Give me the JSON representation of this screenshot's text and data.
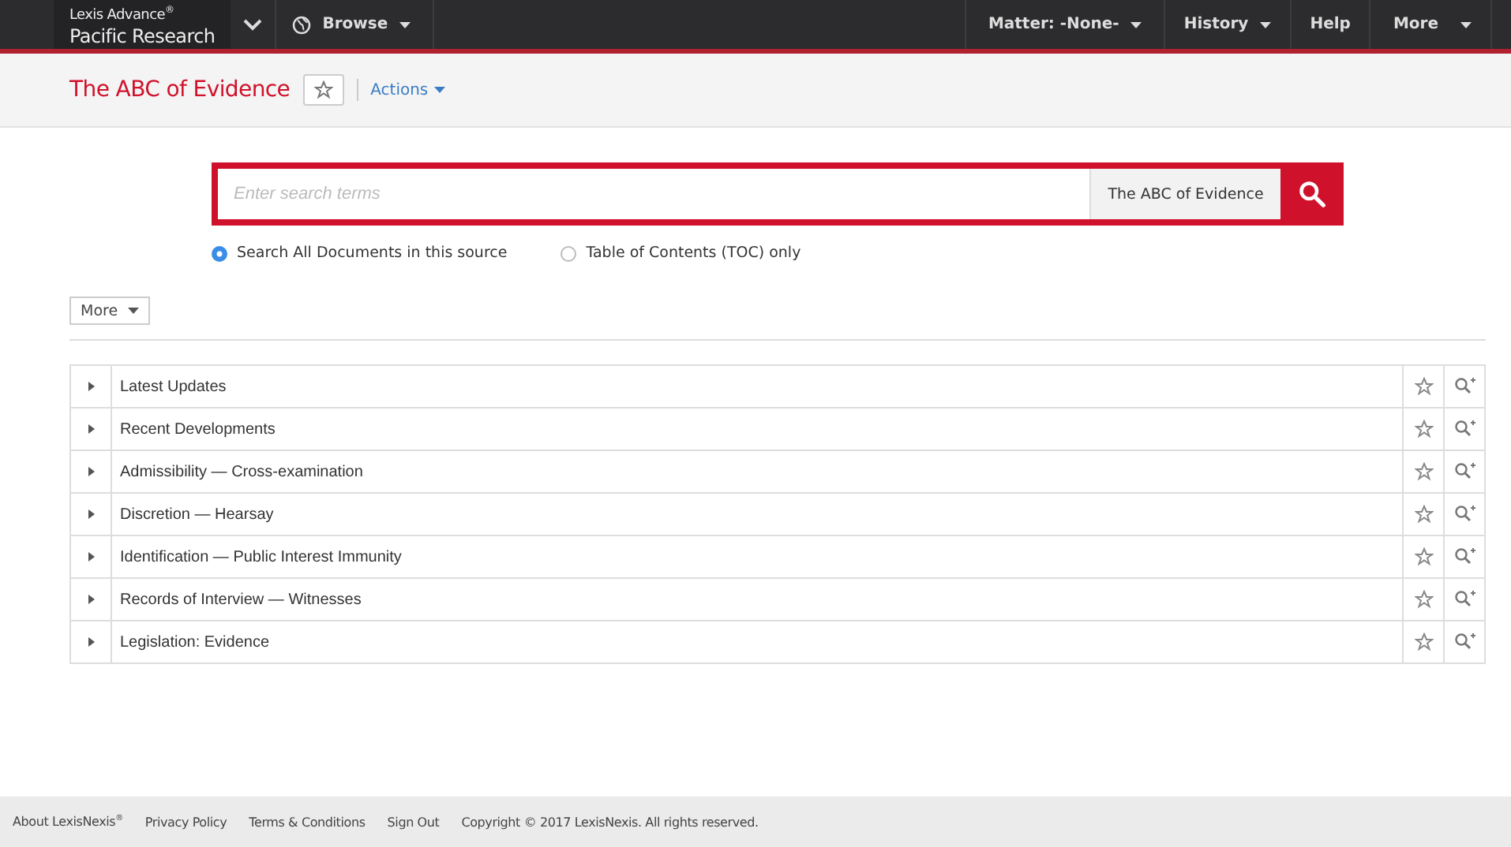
{
  "top_bar": {
    "brand": {
      "product": "Lexis Advance$^{®}$",
      "name": "Pacific Research"
    },
    "left_items": [
      {
        "label": "Browse",
        "kind": "dropdown"
      }
    ],
    "right_items": [
      {
        "label": "Matter: -None-",
        "kind": "dropdown"
      },
      {
        "label": "History",
        "kind": "dropdown"
      },
      {
        "label": "Help",
        "kind": "link"
      },
      {
        "label": "More",
        "kind": "dropdown"
      }
    ]
  },
  "header": {
    "title": "The ABC of Evidence",
    "actions": "Actions"
  },
  "search": {
    "placeholder": "Enter search terms",
    "source": "The ABC of Evidence",
    "scopes": [
      {
        "label": "Search All Documents in this source",
        "selected": true
      },
      {
        "label": "Table of Contents (TOC) only",
        "selected": false
      }
    ]
  },
  "more_button": "More",
  "toc": [
    {
      "label": "Latest Updates",
      "expanded": false
    },
    {
      "label": "Recent Developments",
      "expanded": false
    },
    {
      "label": "Admissibility — Cross-examination",
      "expanded": false
    },
    {
      "label": "Discretion — Hearsay",
      "expanded": false
    },
    {
      "label": "Identification — Public Interest Immunity",
      "expanded": false
    },
    {
      "label": "Records of Interview — Witnesses",
      "expanded": false
    },
    {
      "label": "Legislation: Evidence",
      "expanded": false
    }
  ],
  "footer": [
    "About LexisNexis$^{®}$",
    "Privacy Policy",
    "Terms & Conditions",
    "Sign Out",
    "Copyright © 2017 LexisNexis. All rights reserved."
  ]
}
